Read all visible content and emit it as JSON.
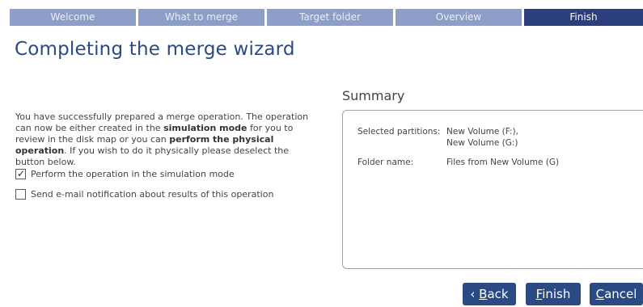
{
  "wizard": {
    "steps": [
      {
        "label": "Welcome"
      },
      {
        "label": "What to merge"
      },
      {
        "label": "Target folder"
      },
      {
        "label": "Overview"
      },
      {
        "label": "Finish"
      }
    ],
    "active_step": "Finish"
  },
  "page": {
    "title": "Completing the merge wizard"
  },
  "description": {
    "part1": "You have successfully prepared a merge operation. The operation can now be either created in the ",
    "bold1": "simulation mode",
    "part2": " for you to review in the disk map or you can ",
    "bold2": "perform the physical operation",
    "part3": ". If you wish to do it physically please deselect the button below."
  },
  "options": {
    "simulation": {
      "label": "Perform the operation in the simulation mode",
      "checked": true
    },
    "email": {
      "label": "Send e-mail notification about results of this operation",
      "checked": false
    }
  },
  "summary": {
    "title": "Summary",
    "partitions_label": "Selected partitions:",
    "partitions_value_1": "New Volume (F:),",
    "partitions_value_2": "New Volume (G:)",
    "folder_label": "Folder name:",
    "folder_value": "Files from New Volume (G)"
  },
  "buttons": {
    "back_prefix": "‹ ",
    "back_mnemonic": "B",
    "back_rest": "ack",
    "finish_mnemonic": "F",
    "finish_rest": "inish",
    "cancel_mnemonic": "C",
    "cancel_rest": "ancel"
  },
  "colors": {
    "step_inactive": "#8d9ec8",
    "step_active": "#2a3f7c",
    "title": "#2a4a84",
    "button": "#2a4a84"
  },
  "icons": {
    "checkbox_checked": "check-mark"
  }
}
